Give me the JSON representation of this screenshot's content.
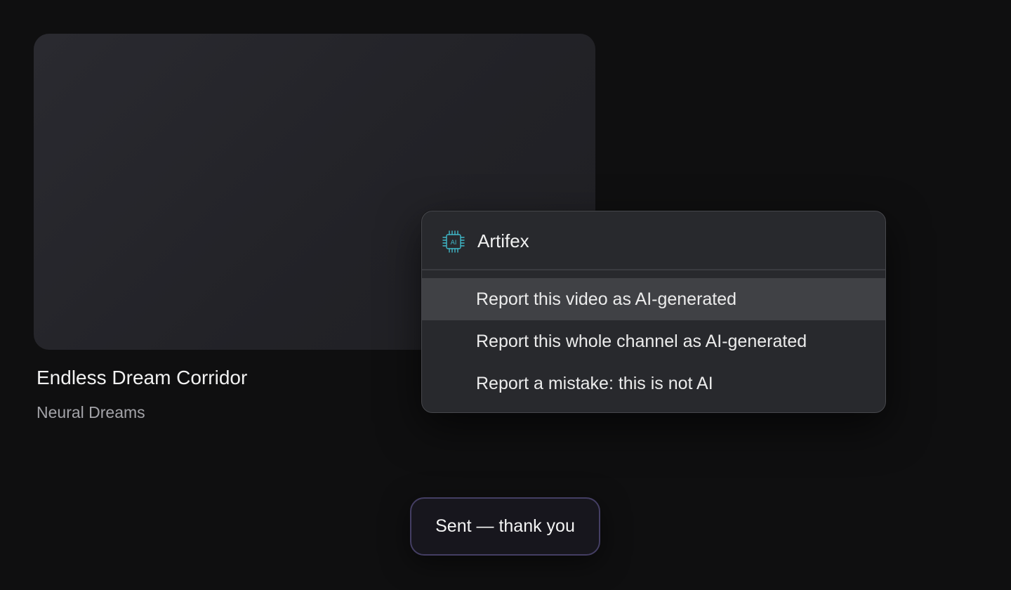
{
  "video": {
    "title": "Endless Dream Corridor",
    "channel": "Neural Dreams"
  },
  "menu": {
    "brand": "Artifex",
    "brand_icon": "ai-chip-icon",
    "brand_icon_label": "AI",
    "accent_color": "#3fb8c8",
    "items": [
      {
        "label": "Report this video as AI-generated",
        "highlighted": true
      },
      {
        "label": "Report this whole channel as AI-generated",
        "highlighted": false
      },
      {
        "label": "Report a mistake: this is not AI",
        "highlighted": false
      }
    ]
  },
  "toast": {
    "message": "Sent — thank you"
  }
}
